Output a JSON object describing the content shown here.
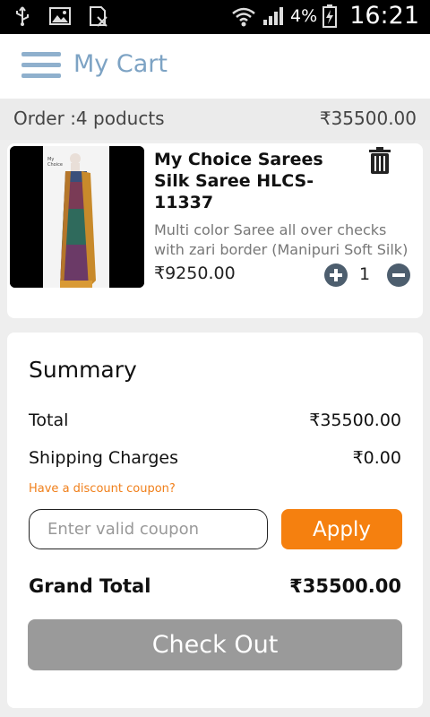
{
  "status_bar": {
    "battery": "4%",
    "time": "16:21",
    "icons": [
      "usb-icon",
      "image-icon",
      "sim-blocked-icon",
      "wifi-icon",
      "signal-icon",
      "battery-charging-icon"
    ]
  },
  "header": {
    "title": "My Cart",
    "menu_icon": "menu-icon"
  },
  "order": {
    "count_label": "Order :4 poducts",
    "total": "₹35500.00"
  },
  "product": {
    "name": "My Choice Sarees Silk Saree HLCS-11337",
    "description": "Multi color Saree all over checks with zari border (Manipuri Soft Silk)",
    "price": "₹9250.00",
    "quantity": "1",
    "icons": {
      "delete": "trash-icon",
      "increase": "plus-circle-icon",
      "decrease": "minus-circle-icon"
    }
  },
  "summary": {
    "title": "Summary",
    "total_label": "Total",
    "total_value": "₹35500.00",
    "shipping_label": "Shipping Charges",
    "shipping_value": "₹0.00",
    "coupon_prompt": "Have a discount coupon?",
    "coupon_placeholder": "Enter valid coupon",
    "apply_label": "Apply",
    "grand_total_label": "Grand Total",
    "grand_total_value": "₹35500.00",
    "checkout_label": "Check Out"
  },
  "colors": {
    "accent": "#f5800f",
    "header_title": "#7da3c4",
    "checkout_disabled": "#9a9a9a"
  }
}
